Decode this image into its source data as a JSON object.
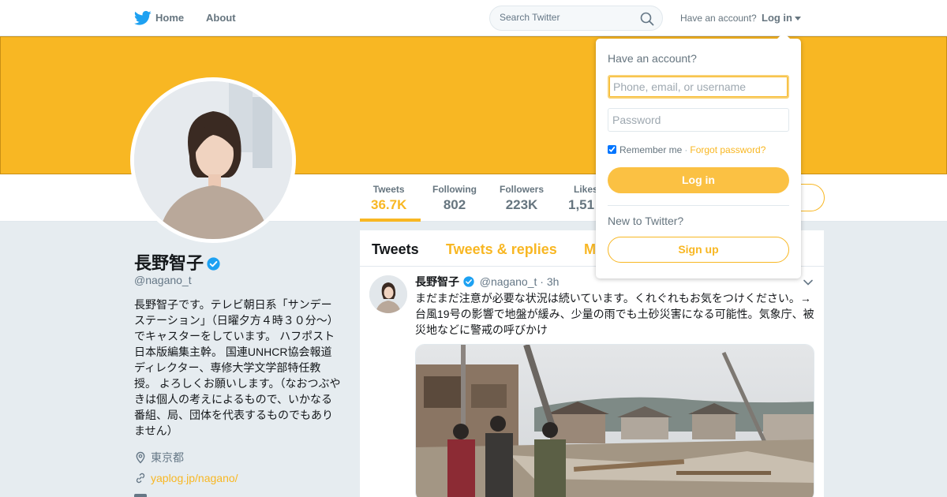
{
  "nav": {
    "home_label": "Home",
    "about_label": "About",
    "search_placeholder": "Search Twitter",
    "have_account": "Have an account?",
    "login_label": "Log in"
  },
  "colors": {
    "accent": "#f8b723",
    "banner": "#f8b723",
    "twitter_blue": "#1da1f2"
  },
  "profile": {
    "name": "長野智子",
    "handle": "@nagano_t",
    "bio": "長野智子です。テレビ朝日系「サンデーステーション」（日曜夕方４時３０分〜）でキャスターをしています。 ハフポスト日本版編集主幹。 国連UNHCR協会報道ディレクター、専修大学文学部特任教授。 よろしくお願いします。（なおつぶやきは個人の考えによるもので、いかなる番組、局、団体を代表するものでもありません）",
    "location": "東京都",
    "website": "yaplog.jp/nagano/"
  },
  "stats": [
    {
      "label": "Tweets",
      "value": "36.7K"
    },
    {
      "label": "Following",
      "value": "802"
    },
    {
      "label": "Followers",
      "value": "223K"
    },
    {
      "label": "Likes",
      "value": "1,51"
    }
  ],
  "timeline": {
    "tabs": [
      "Tweets",
      "Tweets & replies",
      "M"
    ],
    "tweet": {
      "name": "長野智子",
      "handle": "@nagano_t",
      "dot": "·",
      "time": "3h",
      "text": "まだまだ注意が必要な状況は続いています。くれぐれもお気をつけください。→台風19号の影響で地盤が緩み、少量の雨でも土砂災害になる可能性。気象庁、被災地などに警戒の呼びかけ"
    }
  },
  "login_dropdown": {
    "title": "Have an account?",
    "username_placeholder": "Phone, email, or username",
    "password_placeholder": "Password",
    "remember_me": "Remember me",
    "separator": "·",
    "forgot_password": "Forgot password?",
    "login_button": "Log in",
    "new_to_twitter": "New to Twitter?",
    "signup_button": "Sign up"
  }
}
